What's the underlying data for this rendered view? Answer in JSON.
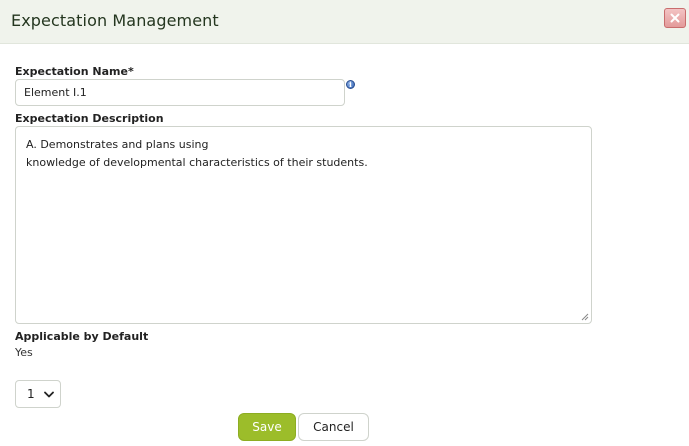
{
  "dialog": {
    "title": "Expectation Management",
    "close_icon": "close-icon"
  },
  "form": {
    "name_label": "Expectation Name*",
    "name_value": "Element I.1",
    "info_icon": "info-icon",
    "info_glyph": "i",
    "description_label": "Expectation Description",
    "description_value": "A. Demonstrates and plans using\nknowledge of developmental characteristics of their students.",
    "applicable_label": "Applicable by Default",
    "applicable_value": "Yes",
    "order_select_value": "1"
  },
  "actions": {
    "save_label": "Save",
    "cancel_label": "Cancel",
    "save_color": "#9cbd2a"
  }
}
